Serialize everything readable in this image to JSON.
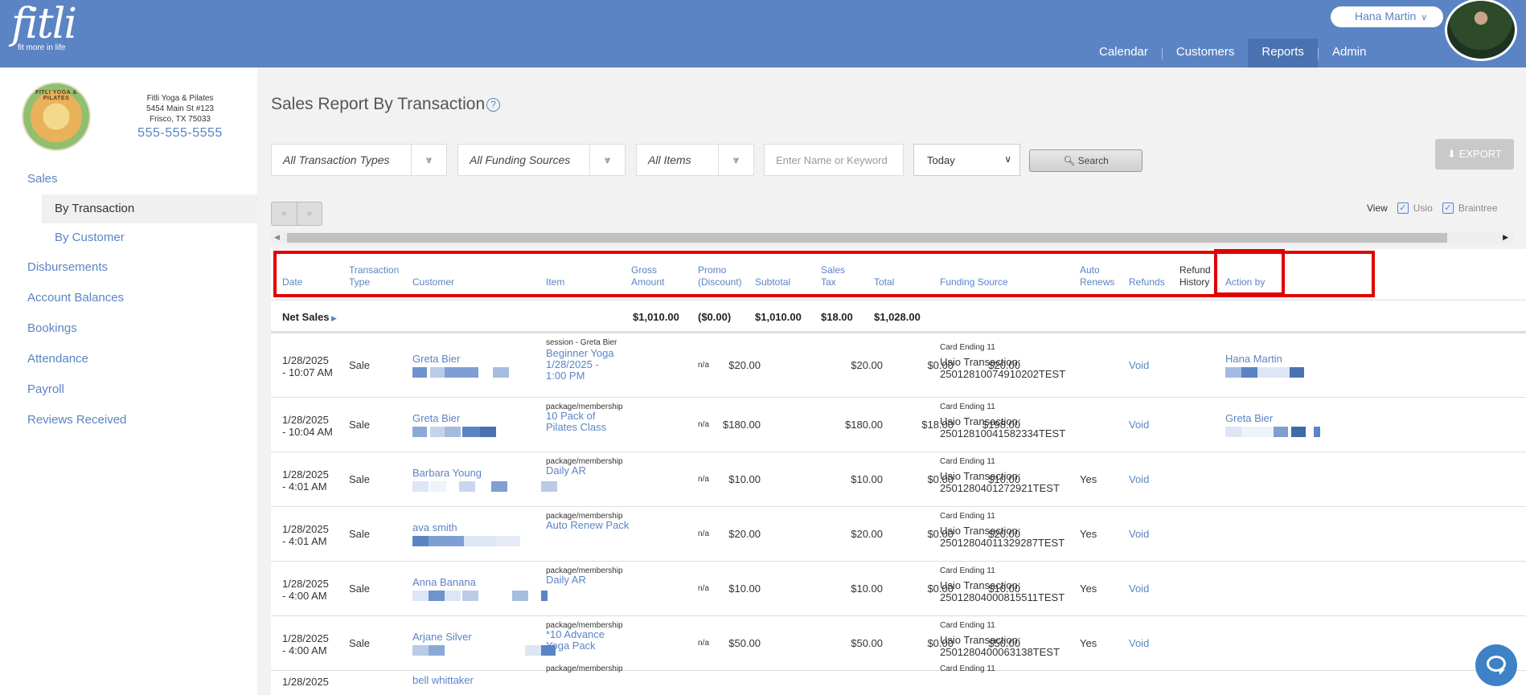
{
  "brand": {
    "name": "fitli",
    "tagline": "fit more in life"
  },
  "user": {
    "name": "Hana Martin"
  },
  "nav": [
    {
      "label": "Calendar",
      "active": false
    },
    {
      "label": "Customers",
      "active": false
    },
    {
      "label": "Reports",
      "active": true
    },
    {
      "label": "Admin",
      "active": false
    }
  ],
  "studio": {
    "logo_text": "FITLI YOGA & PILATES",
    "name": "Fitli Yoga & Pilates",
    "address1": "5454 Main St #123",
    "address2": "Frisco, TX 75033",
    "phone": "555-555-5555"
  },
  "sidebar": {
    "sales": "Sales",
    "by_transaction": "By Transaction",
    "by_customer": "By Customer",
    "disbursements": "Disbursements",
    "account_balances": "Account Balances",
    "bookings": "Bookings",
    "attendance": "Attendance",
    "payroll": "Payroll",
    "reviews": "Reviews Received"
  },
  "page": {
    "title": "Sales Report By Transaction",
    "help": "?"
  },
  "filters": {
    "transaction_types": "All Transaction Types",
    "funding_sources": "All Funding Sources",
    "items": "All Items",
    "keyword_placeholder": "Enter Name or Keyword",
    "date_range": "Today",
    "search": "Search",
    "export": "EXPORT"
  },
  "pager": {
    "prev": "«",
    "next": "»"
  },
  "view": {
    "label": "View",
    "usio": "Usio",
    "braintree": "Braintree"
  },
  "columns": {
    "date": "Date",
    "txn_type_1": "Transaction",
    "txn_type_2": "Type",
    "customer": "Customer",
    "item": "Item",
    "gross_1": "Gross",
    "gross_2": "Amount",
    "promo_1": "Promo",
    "promo_2": "(Discount)",
    "subtotal": "Subtotal",
    "tax_1": "Sales",
    "tax_2": "Tax",
    "total": "Total",
    "funding": "Funding Source",
    "auto_1": "Auto",
    "auto_2": "Renews",
    "refunds": "Refunds",
    "refund_hist_1": "Refund",
    "refund_hist_2": "History",
    "action_by": "Action by"
  },
  "net_sales": {
    "label": "Net Sales",
    "gross": "$1,010.00",
    "promo": "($0.00)",
    "subtotal": "$1,010.00",
    "tax": "$18.00",
    "total": "$1,028.00"
  },
  "rows": [
    {
      "date1": "1/28/2025",
      "date2": "- 10:07 AM",
      "type": "Sale",
      "customer": "Greta Bier",
      "item_cat": "session - Greta Bier",
      "item1": "Beginner Yoga",
      "item2": "1/28/2025 -",
      "item3": "1:00 PM",
      "gross": "$20.00",
      "promo": "n/a",
      "subtotal": "$20.00",
      "tax": "$0.00",
      "total": "$20.00",
      "card": "Card Ending 11",
      "fund1": "Usio Transaction:",
      "fund2": "25012810074910202TEST",
      "auto": "",
      "refund": "Void",
      "action": "Hana Martin"
    },
    {
      "date1": "1/28/2025",
      "date2": "- 10:04 AM",
      "type": "Sale",
      "customer": "Greta Bier",
      "item_cat": "package/membership",
      "item1": "10 Pack of",
      "item2": "Pilates Class",
      "item3": "",
      "gross": "$180.00",
      "promo": "n/a",
      "subtotal": "$180.00",
      "tax": "$18.00",
      "total": "$198.00",
      "card": "Card Ending 11",
      "fund1": "Usio Transaction:",
      "fund2": "25012810041582334TEST",
      "auto": "",
      "refund": "Void",
      "action": "Greta Bier"
    },
    {
      "date1": "1/28/2025",
      "date2": "- 4:01 AM",
      "type": "Sale",
      "customer": "Barbara Young",
      "item_cat": "package/membership",
      "item1": "Daily AR",
      "item2": "",
      "item3": "",
      "gross": "$10.00",
      "promo": "n/a",
      "subtotal": "$10.00",
      "tax": "$0.00",
      "total": "$10.00",
      "card": "Card Ending 11",
      "fund1": "Usio Transaction:",
      "fund2": "2501280401272921TEST",
      "auto": "Yes",
      "refund": "Void",
      "action": ""
    },
    {
      "date1": "1/28/2025",
      "date2": "- 4:01 AM",
      "type": "Sale",
      "customer": "ava smith",
      "item_cat": "package/membership",
      "item1": "Auto Renew Pack",
      "item2": "",
      "item3": "",
      "gross": "$20.00",
      "promo": "n/a",
      "subtotal": "$20.00",
      "tax": "$0.00",
      "total": "$20.00",
      "card": "Card Ending 11",
      "fund1": "Usio Transaction:",
      "fund2": "25012804011329287TEST",
      "auto": "Yes",
      "refund": "Void",
      "action": ""
    },
    {
      "date1": "1/28/2025",
      "date2": "- 4:00 AM",
      "type": "Sale",
      "customer": "Anna Banana",
      "item_cat": "package/membership",
      "item1": "Daily AR",
      "item2": "",
      "item3": "",
      "gross": "$10.00",
      "promo": "n/a",
      "subtotal": "$10.00",
      "tax": "$0.00",
      "total": "$10.00",
      "card": "Card Ending 11",
      "fund1": "Usio Transaction:",
      "fund2": "25012804000815511TEST",
      "auto": "Yes",
      "refund": "Void",
      "action": ""
    },
    {
      "date1": "1/28/2025",
      "date2": "- 4:00 AM",
      "type": "Sale",
      "customer": "Arjane Silver",
      "item_cat": "package/membership",
      "item1": "*10 Advance",
      "item2": "Yoga Pack",
      "item3": "",
      "gross": "$50.00",
      "promo": "n/a",
      "subtotal": "$50.00",
      "tax": "$0.00",
      "total": "$50.00",
      "card": "Card Ending 11",
      "fund1": "Usio Transaction:",
      "fund2": "2501280400063138TEST",
      "auto": "Yes",
      "refund": "Void",
      "action": ""
    },
    {
      "date1": "1/28/2025",
      "date2": "",
      "type": "",
      "customer": "bell whittaker",
      "item_cat": "package/membership",
      "item1": "",
      "item2": "",
      "item3": "",
      "gross": "",
      "promo": "",
      "subtotal": "",
      "tax": "",
      "total": "",
      "card": "Card Ending 11",
      "fund1": "",
      "fund2": "",
      "auto": "",
      "refund": "",
      "action": ""
    }
  ],
  "colors": {
    "brand": "#5b84c4",
    "highlight": "#e10000"
  }
}
